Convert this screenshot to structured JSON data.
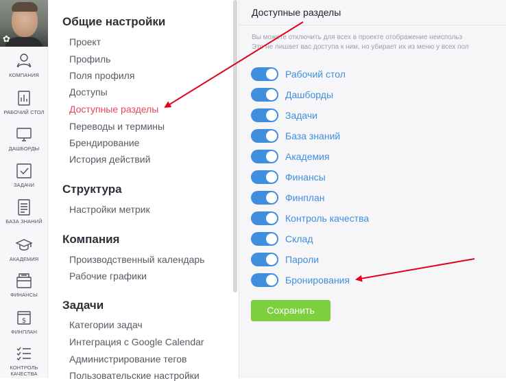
{
  "rail": {
    "items": [
      {
        "label": "КОМПАНИЯ",
        "icon": "company-icon"
      },
      {
        "label": "РАБОЧИЙ СТОЛ",
        "icon": "desktop-icon"
      },
      {
        "label": "ДАШБОРДЫ",
        "icon": "monitor-icon"
      },
      {
        "label": "ЗАДАЧИ",
        "icon": "checkbox-icon"
      },
      {
        "label": "БАЗА ЗНАНИЙ",
        "icon": "document-icon"
      },
      {
        "label": "АКАДЕМИЯ",
        "icon": "graduation-cap-icon"
      },
      {
        "label": "ФИНАНСЫ",
        "icon": "wallet-icon"
      },
      {
        "label": "ФИНПЛАН",
        "icon": "dollar-icon"
      },
      {
        "label": "КОНТРОЛЬ КАЧЕСТВА",
        "icon": "checklist-icon"
      }
    ]
  },
  "nav": {
    "sections": [
      {
        "heading": "Общие настройки",
        "items": [
          "Проект",
          "Профиль",
          "Поля профиля",
          "Доступы",
          "Доступные разделы",
          "Переводы и термины",
          "Брендирование",
          "История действий"
        ]
      },
      {
        "heading": "Структура",
        "items": [
          "Настройки метрик"
        ]
      },
      {
        "heading": "Компания",
        "items": [
          "Производственный календарь",
          "Рабочие графики"
        ]
      },
      {
        "heading": "Задачи",
        "items": [
          "Категории задач",
          "Интеграция с Google Calendar",
          "Администрирование тегов",
          "Пользовательские настройки"
        ]
      }
    ],
    "active": "Доступные разделы"
  },
  "content": {
    "title": "Доступные разделы",
    "description_line1": "Вы можете отключить для всех в проекте отображение неиспольз",
    "description_line2": "Это не лишает вас доступа к ним, но убирает их из меню у всех пол",
    "toggles": [
      {
        "label": "Рабочий стол",
        "on": true
      },
      {
        "label": "Дашборды",
        "on": true
      },
      {
        "label": "Задачи",
        "on": true
      },
      {
        "label": "База знаний",
        "on": true
      },
      {
        "label": "Академия",
        "on": true
      },
      {
        "label": "Финансы",
        "on": true
      },
      {
        "label": "Финплан",
        "on": true
      },
      {
        "label": "Контроль качества",
        "on": true
      },
      {
        "label": "Склад",
        "on": true
      },
      {
        "label": "Пароли",
        "on": true
      },
      {
        "label": "Бронирования",
        "on": true
      }
    ],
    "save_label": "Сохранить"
  },
  "colors": {
    "accent_blue": "#3f8fde",
    "active_red": "#e8465f",
    "save_green": "#7ccf3e",
    "annotation_red": "#e3001b"
  }
}
